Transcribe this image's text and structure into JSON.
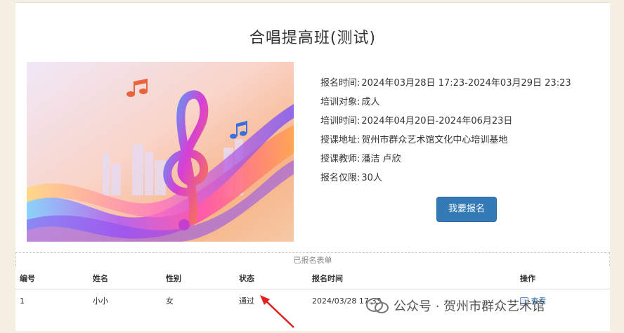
{
  "course": {
    "title": "合唱提高班(测试)"
  },
  "details": [
    {
      "label": "报名时间:",
      "value": "2024年03月28日 17:23-2024年03月29日 23:23"
    },
    {
      "label": "培训对象:",
      "value": "成人"
    },
    {
      "label": "培训时间:",
      "value": "2024年04月20日-2024年06月23日"
    },
    {
      "label": "授课地址:",
      "value": "贺州市群众艺术馆文化中心培训基地"
    },
    {
      "label": "授课教师:",
      "value": "潘洁 卢欣"
    },
    {
      "label": "报名仅限:",
      "value": "30人"
    }
  ],
  "enroll_button": "我要报名",
  "registration": {
    "caption": "已报名表单",
    "headers": [
      "编号",
      "姓名",
      "性别",
      "状态",
      "报名时间",
      "操作"
    ],
    "rows": [
      {
        "id": "1",
        "name": "小小",
        "gender": "女",
        "status": "通过",
        "time": "2024/03/28 17:33",
        "action": "查看"
      }
    ]
  },
  "watermark": "公众号 · 贺州市群众艺术馆",
  "colors": {
    "button": "#337ab7",
    "page_bg": "#f4efe2"
  }
}
